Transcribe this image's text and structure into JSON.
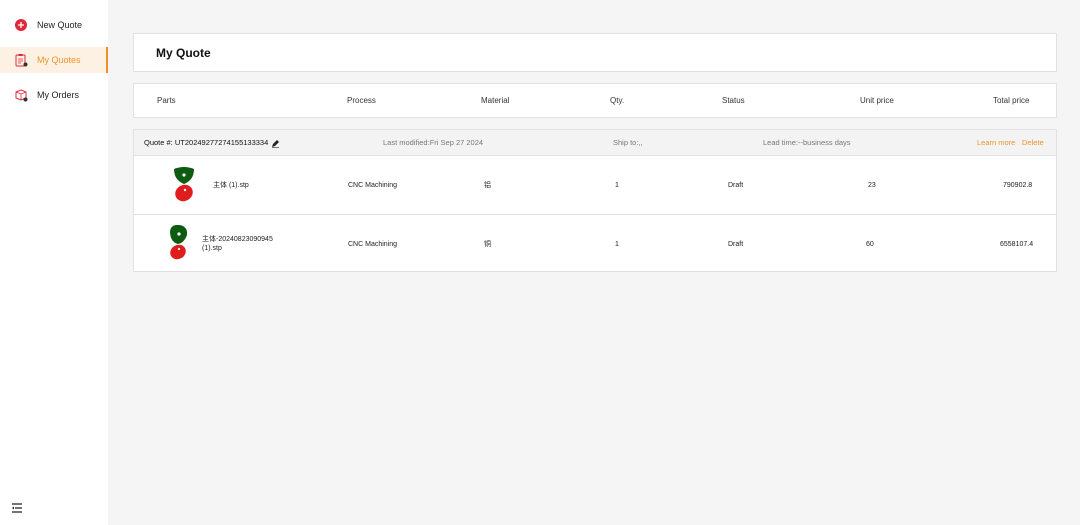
{
  "sidebar": {
    "items": [
      {
        "label": "New Quote",
        "icon": "plus-circle-icon"
      },
      {
        "label": "My Quotes",
        "icon": "clipboard-icon",
        "active": true
      },
      {
        "label": "My Orders",
        "icon": "box-icon"
      }
    ],
    "collapse_icon": "menu-collapse-icon"
  },
  "page": {
    "title": "My Quote"
  },
  "table": {
    "headers": [
      "Parts",
      "Process",
      "Material",
      "Qty.",
      "Status",
      "Unit price",
      "Total price"
    ]
  },
  "quote": {
    "id": "Quote #: UT20249277274155133334",
    "last_modified": "Last modified:Fri Sep 27 2024",
    "ship_to": "Ship to:,,",
    "lead_time": "Lead time:--business days",
    "learn_more": "Learn more",
    "delete": "Delete",
    "rows": [
      {
        "part": "主体 (1).stp",
        "process": "CNC Machining",
        "material": "铝",
        "qty": "1",
        "status": "Draft",
        "unit_price": "23",
        "total_price": "790902.8"
      },
      {
        "part": "主体-20240823090945 (1).stp",
        "process": "CNC Machining",
        "material": "铜",
        "qty": "1",
        "status": "Draft",
        "unit_price": "60",
        "total_price": "6558107.4"
      }
    ]
  },
  "colors": {
    "accent": "#f0922b",
    "brand_red": "#e0283a",
    "part_green": "#0e5b12",
    "part_red": "#e01d1d"
  }
}
